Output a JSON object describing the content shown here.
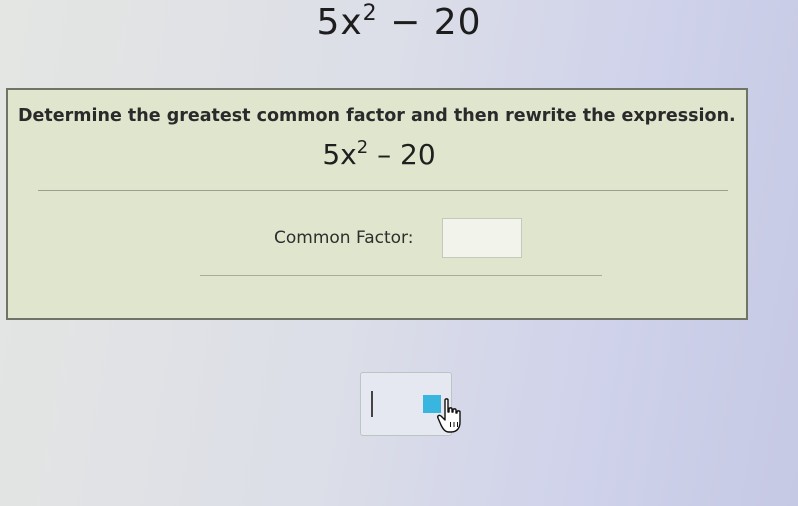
{
  "header": {
    "expression_base": "5x",
    "expression_exponent": "2",
    "expression_tail": " − 20"
  },
  "question": {
    "instruction": "Determine the greatest common factor and then rewrite the expression.",
    "expression_base": "5x",
    "expression_exponent": "2",
    "expression_tail": " – 20",
    "common_factor_label": "Common Factor:",
    "common_factor_value": ""
  },
  "answer_area": {
    "value": ""
  },
  "icons": {
    "cursor": "hand-pointer-icon",
    "caret": "text-caret-icon",
    "selector": "blue-square-icon"
  },
  "colors": {
    "panel_bg": "#dfe6cd",
    "accent": "#39b6df"
  }
}
